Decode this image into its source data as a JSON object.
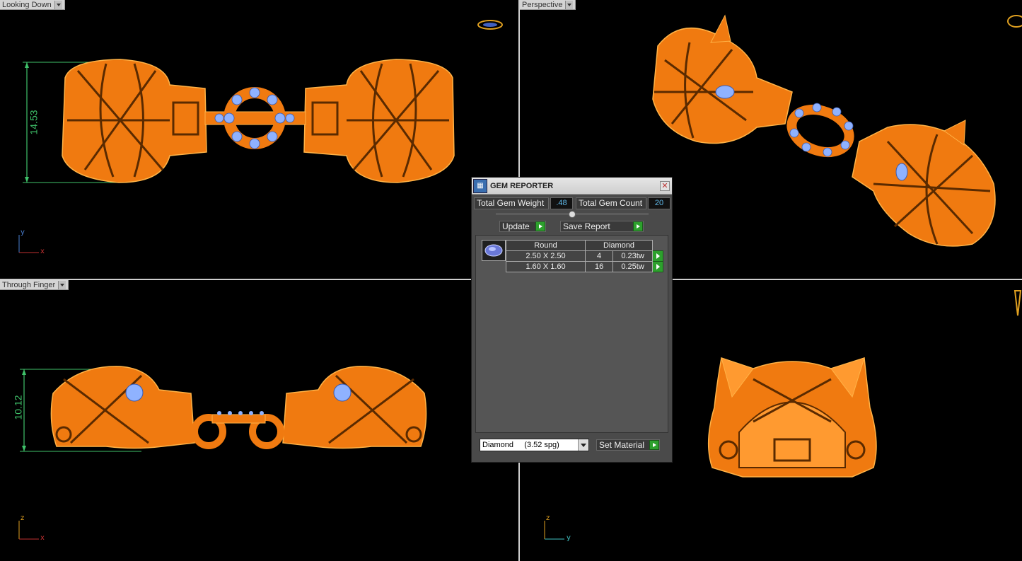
{
  "viewports": {
    "top_left": {
      "label": "Looking Down",
      "dimension": "14.53",
      "axis_v": "y",
      "axis_h": "x"
    },
    "top_right": {
      "label": "Perspective"
    },
    "bottom_left": {
      "label": "Through Finger",
      "dimension": "10.12",
      "axis_v": "z",
      "axis_h": "x"
    },
    "bottom_right": {
      "label": "",
      "axis_v": "z",
      "axis_h": "y"
    }
  },
  "gem_reporter": {
    "title": "GEM REPORTER",
    "total_weight_label": "Total Gem Weight",
    "total_weight_value": ".48",
    "total_count_label": "Total Gem Count",
    "total_count_value": "20",
    "update_label": "Update",
    "save_report_label": "Save Report",
    "table": {
      "headers": [
        "Round",
        "Diamond"
      ],
      "rows": [
        {
          "size": "2.50 X 2.50",
          "count": "4",
          "weight": "0.23tw"
        },
        {
          "size": "1.60 X 1.60",
          "count": "16",
          "weight": "0.25tw"
        }
      ]
    },
    "material_selected": "Diamond     (3.52 spg)",
    "set_material_label": "Set Material"
  },
  "colors": {
    "metal": "#f07a10",
    "metal_light": "#ffb347",
    "gem": "#8fb2ff",
    "dimension": "#3fc26a"
  }
}
